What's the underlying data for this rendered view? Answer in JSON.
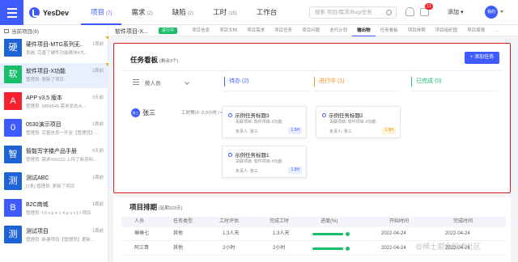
{
  "app": {
    "logo_text": "YesDev"
  },
  "nav": [
    {
      "label": "项目",
      "count": "(7)",
      "active": true
    },
    {
      "label": "需求",
      "count": "(2)"
    },
    {
      "label": "缺陷",
      "count": "(2)"
    },
    {
      "label": "工时",
      "count": "(15)"
    },
    {
      "label": "工作台",
      "count": ""
    }
  ],
  "header": {
    "search_placeholder": "搜索 项目/需求/Bug/任务",
    "notification_count": "11",
    "add_label": "添加",
    "avatar_text": "我的"
  },
  "sidebar": {
    "heading": "当前项目(8)",
    "projects": [
      {
        "initial": "硬",
        "color": "#1e63d6",
        "title": "硬件项目-MTG系列无...",
        "sub": "系统, 完善了硬件功能模块4大...",
        "time": "1周前"
      },
      {
        "initial": "软",
        "color": "#19be6b",
        "title": "软件项目-X功能",
        "sub": "管理员: 更新了项目",
        "time": "1周前",
        "active": true
      },
      {
        "initial": "A",
        "color": "#f5222d",
        "title": "APP v3.5 版本",
        "sub": "管理员: 5854545 需求状态从...",
        "time": "3天前"
      },
      {
        "initial": "0",
        "color": "#3e5bff",
        "title": "0530演示项目",
        "sub": "管理员: 完善信息一升至【管理员】...",
        "time": "1周前"
      },
      {
        "initial": "智",
        "color": "#1e63d6",
        "title": "智能写字楼产品手册",
        "sub": "管理员: 需求#0c010 上传了新资料...",
        "time": "6天前"
      },
      {
        "initial": "测",
        "color": "#1e63d6",
        "title": "测试ABC",
        "sub": "[1条] 管理员: 更新了项目",
        "time": "1周前"
      },
      {
        "initial": "B",
        "color": "#3e5bff",
        "title": "B2C商城",
        "sub": "管理员: f d x p e v 4 p o t 1 f 项目",
        "time": "1周前"
      },
      {
        "initial": "测",
        "color": "#1e63d6",
        "title": "测试项目",
        "sub": "管理员: 新建项目【管理员】更新...",
        "time": "1周前"
      }
    ]
  },
  "subbar": {
    "crumb": "软件项目-X...",
    "status": "进行中",
    "tabs": [
      "项目信息",
      "项目文档",
      "项目需求",
      "项目任务",
      "项目问题",
      "迭代计划",
      "输出物",
      "任务看板",
      "项目排期",
      "项目组织图",
      "项目周报",
      "…"
    ],
    "active_tab": "输出物"
  },
  "board": {
    "title": "任务看板",
    "remaining": "(剩余3个)",
    "add_button": "+ 添加任务",
    "assignee_label": "按人员",
    "columns": [
      "待办 (2)",
      "进行中 (1)",
      "已完成 (0)"
    ],
    "user": {
      "avatar_text": "张三",
      "name": "张三",
      "hours": "工时预计: 0.0小时 / 4.5小时"
    },
    "cards": [
      {
        "title": "示例任务标题3",
        "project": "关联项目: 软件项目-X功能",
        "assignee": "负责人: 张三",
        "hours": "1.5H",
        "col": 0,
        "row": 0
      },
      {
        "title": "示例任务标题1",
        "project": "关联项目: 软件项目-X功能",
        "assignee": "负责人: 张三",
        "hours": "1.5H",
        "col": 0,
        "row": 1
      },
      {
        "title": "示例任务标题2",
        "project": "关联项目: 软件项目-X功能",
        "assignee": "负责人: 张三",
        "hours": "1.5H",
        "col": 1,
        "row": 0
      }
    ]
  },
  "schedule": {
    "title": "项目排期",
    "remaining": "(延期103天)",
    "headers": [
      "人员",
      "任务类型",
      "工时评估",
      "完成工时",
      "进度(%)",
      "开始时间",
      "完成时间"
    ],
    "rows": [
      {
        "name": "琳琳七",
        "type": "其他",
        "estimate": "1.3人天",
        "done": "1.3人天",
        "progress": 1.0,
        "start": "2022-04-24",
        "end": "2022-04-24"
      },
      {
        "name": "阿三哥",
        "type": "其他",
        "estimate": "2小时",
        "done": "2小时",
        "progress": 1.0,
        "start": "2022-04-24",
        "end": "2022-04-24"
      }
    ]
  },
  "watermark": "@稀土掘金技术社区",
  "colors": {
    "primary": "#3e5bff",
    "success": "#19be6b",
    "warning": "#fa8c16",
    "highlight_border": "#e02020"
  }
}
